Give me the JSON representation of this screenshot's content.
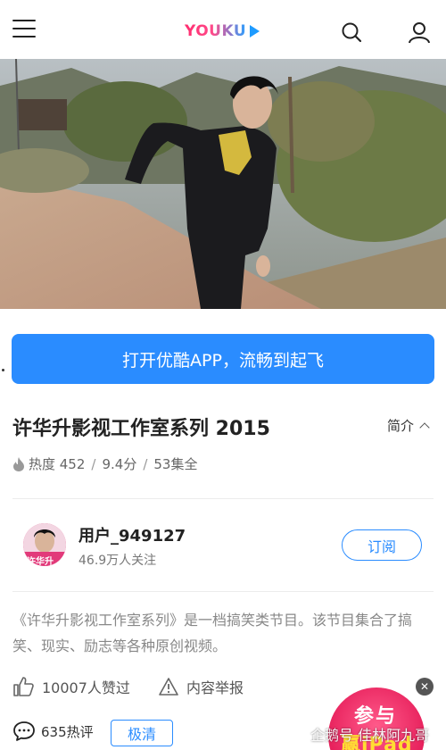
{
  "header": {
    "logo_text": "YOUKU",
    "icons": [
      "menu-icon",
      "search-icon",
      "user-icon"
    ]
  },
  "cta": {
    "label": "打开优酷APP，流畅到起飞"
  },
  "show": {
    "title": "许华升影视工作室系列 2015",
    "intro_label": "简介",
    "heat_label": "热度 452",
    "rating_label": "9.4分",
    "episodes_label": "53集全",
    "separator": "/"
  },
  "uploader": {
    "name": "用户_949127",
    "followers": "46.9万人关注",
    "subscribe_label": "订阅",
    "avatar_text": "许华升"
  },
  "description": "《许华升影视工作室系列》是一档搞笑类节目。该节目集合了搞笑、现实、励志等各种原创视频。",
  "actions": {
    "like_label": "10007人赞过",
    "report_label": "内容举报",
    "comment_label": "635热评",
    "quality_label": "极清"
  },
  "promo": {
    "line1": "参与",
    "line2": "赢iPad"
  },
  "watermark": {
    "text": "企鹅号 佳林阿九哥"
  },
  "colors": {
    "accent": "#2a8cff",
    "logo_pink": "#ff2d6f",
    "text_dark": "#222222",
    "text_muted": "#888888"
  }
}
